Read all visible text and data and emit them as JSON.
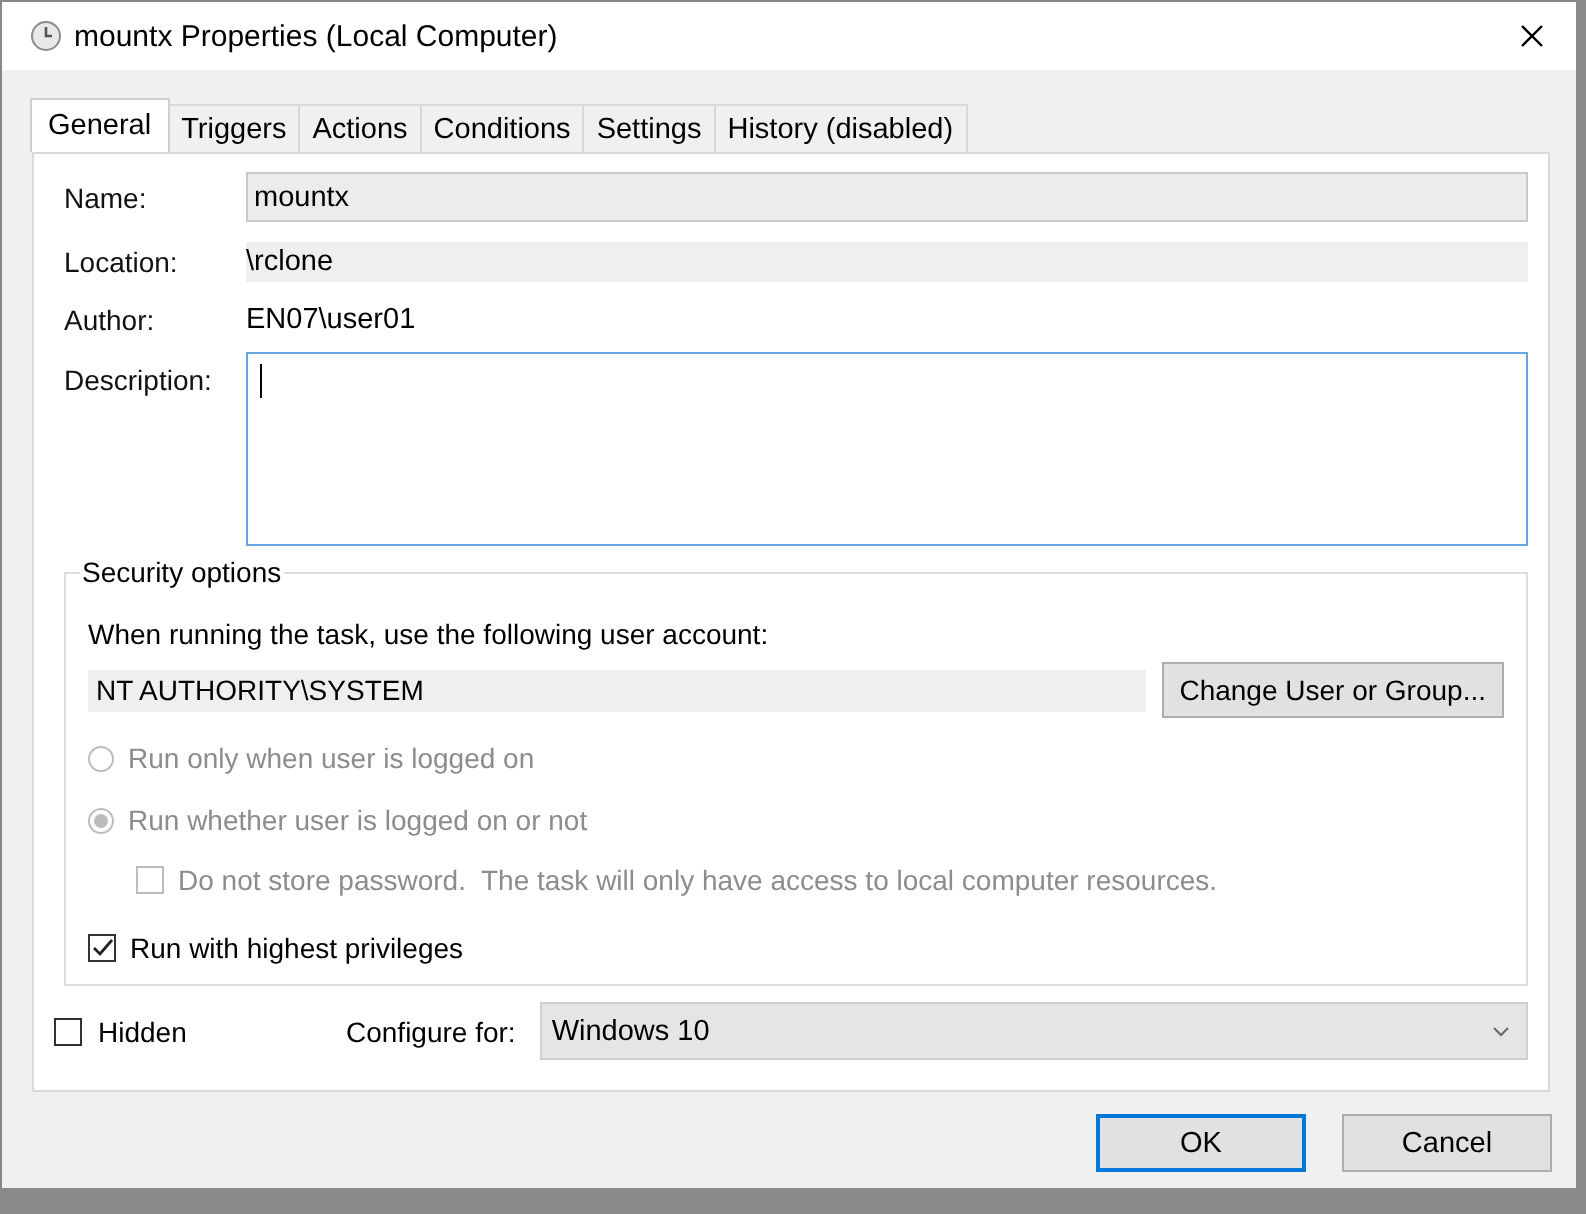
{
  "window": {
    "title": "mountx Properties (Local Computer)"
  },
  "tabs": [
    {
      "label": "General",
      "selected": true
    },
    {
      "label": "Triggers",
      "selected": false
    },
    {
      "label": "Actions",
      "selected": false
    },
    {
      "label": "Conditions",
      "selected": false
    },
    {
      "label": "Settings",
      "selected": false
    },
    {
      "label": "History (disabled)",
      "selected": false
    }
  ],
  "general": {
    "name": {
      "label": "Name:",
      "value": "mountx"
    },
    "location": {
      "label": "Location:",
      "value": "\\rclone"
    },
    "author": {
      "label": "Author:",
      "value": "EN07\\user01"
    },
    "description": {
      "label": "Description:",
      "focused": true
    }
  },
  "security": {
    "title": "Security options",
    "prompt": "When running the task, use the following user account:",
    "account": "NT AUTHORITY\\SYSTEM",
    "change_button": "Change User or Group...",
    "options": [
      {
        "kind": "radio",
        "label": "Run only when user is logged on",
        "selected": false,
        "disabled": true
      },
      {
        "kind": "radio",
        "label": "Run whether user is logged on or not",
        "selected": true,
        "disabled": true
      },
      {
        "kind": "checkbox",
        "label": "Do not store password.  The task will only have access to local computer resources.",
        "checked": false,
        "disabled": true
      },
      {
        "kind": "checkbox",
        "label": "Run with highest privileges",
        "checked": true,
        "disabled": false
      }
    ]
  },
  "hidden": {
    "label": "Hidden",
    "checked": false
  },
  "configure": {
    "label": "Configure for:",
    "value": "Windows 10"
  },
  "buttons": [
    {
      "label": "OK",
      "kind": "default"
    },
    {
      "label": "Cancel",
      "kind": "normal"
    }
  ]
}
